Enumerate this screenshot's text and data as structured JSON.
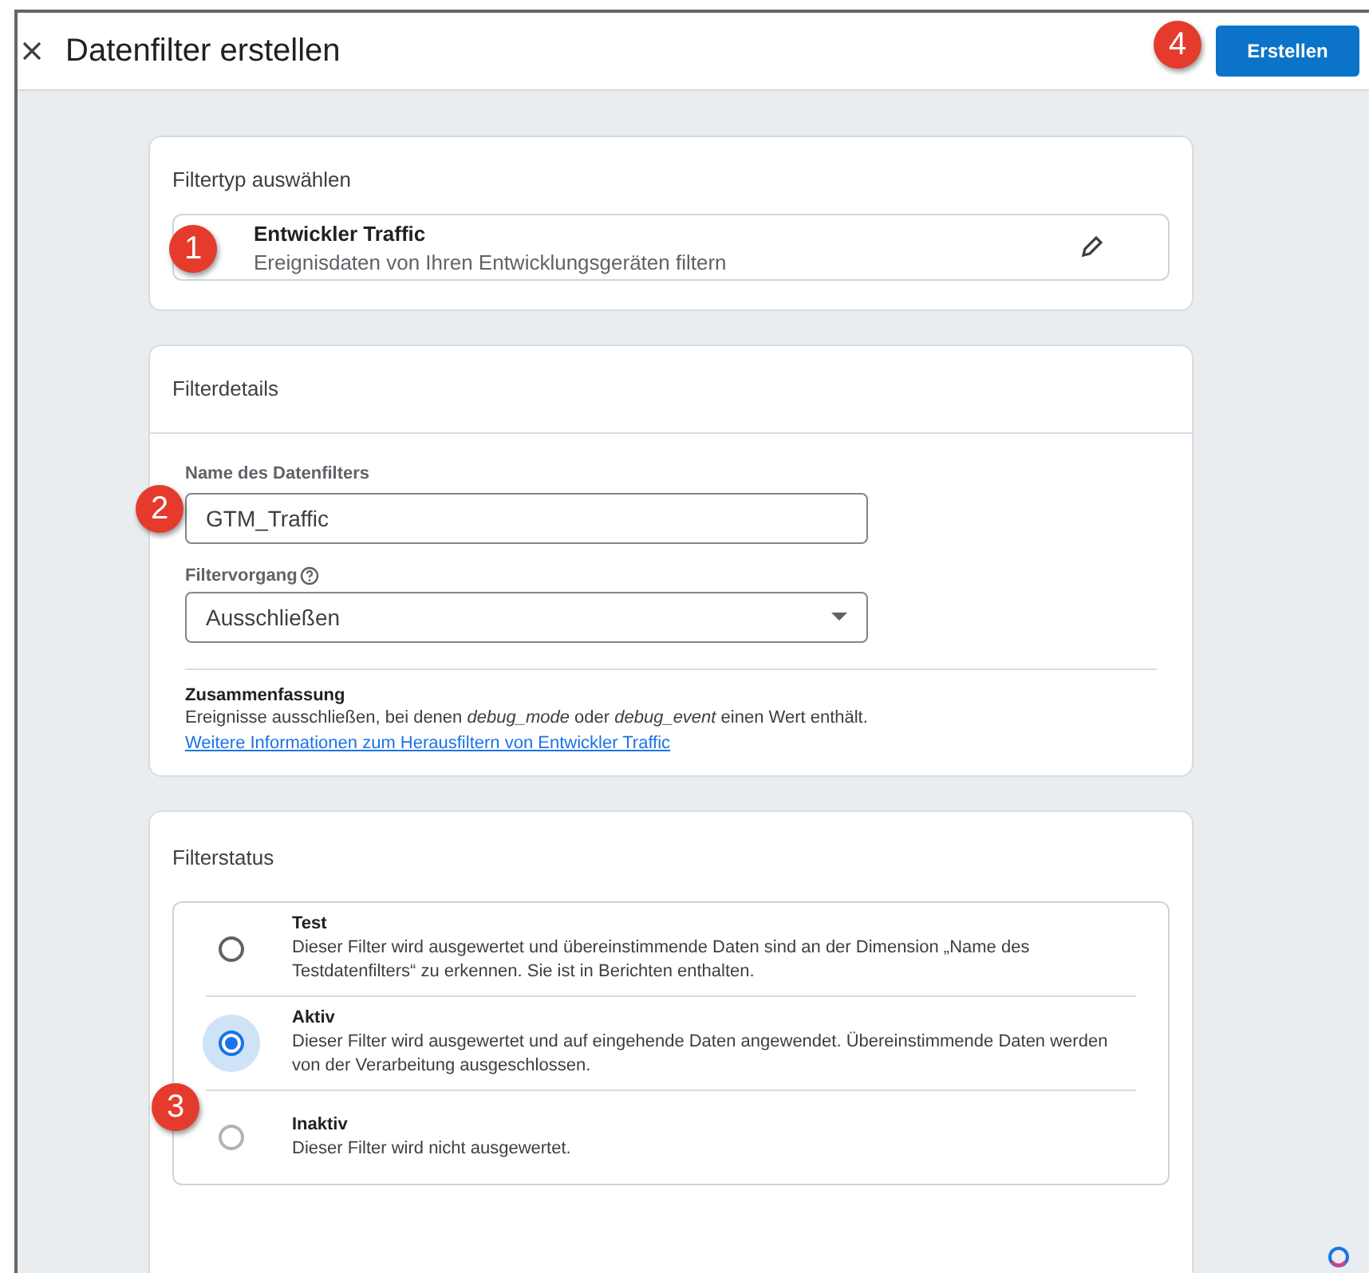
{
  "header": {
    "title": "Datenfilter erstellen",
    "create_button": "Erstellen"
  },
  "filter_type": {
    "heading": "Filtertyp auswählen",
    "name": "Entwickler Traffic",
    "description": "Ereignisdaten von Ihren Entwicklungsgeräten filtern"
  },
  "filter_details": {
    "heading": "Filterdetails",
    "name_label": "Name des Datenfilters",
    "name_value": "GTM_Traffic",
    "operation_label": "Filtervorgang",
    "operation_value": "Ausschließen",
    "summary_heading": "Zusammenfassung",
    "summary_text": "Ereignisse ausschließen, bei denen *debug_mode* oder *debug_event* einen Wert enthält.",
    "summary_link": "Weitere Informationen zum Herausfiltern von Entwickler Traffic"
  },
  "filter_status": {
    "heading": "Filterstatus",
    "options": [
      {
        "label": "Test",
        "description": "Dieser Filter wird ausgewertet und übereinstimmende Daten sind an der Dimension „Name des Testdatenfilters“ zu erkennen. Sie ist in Berichten enthalten.",
        "selected": false,
        "disabled": false
      },
      {
        "label": "Aktiv",
        "description": "Dieser Filter wird ausgewertet und auf eingehende Daten angewendet. Übereinstimmende Daten werden von der Verarbeitung ausgeschlossen.",
        "selected": true,
        "disabled": false
      },
      {
        "label": "Inaktiv",
        "description": "Dieser Filter wird nicht ausgewertet.",
        "selected": false,
        "disabled": true
      }
    ]
  },
  "callouts": [
    {
      "label": "1"
    },
    {
      "label": "2"
    },
    {
      "label": "3"
    },
    {
      "label": "4"
    }
  ]
}
